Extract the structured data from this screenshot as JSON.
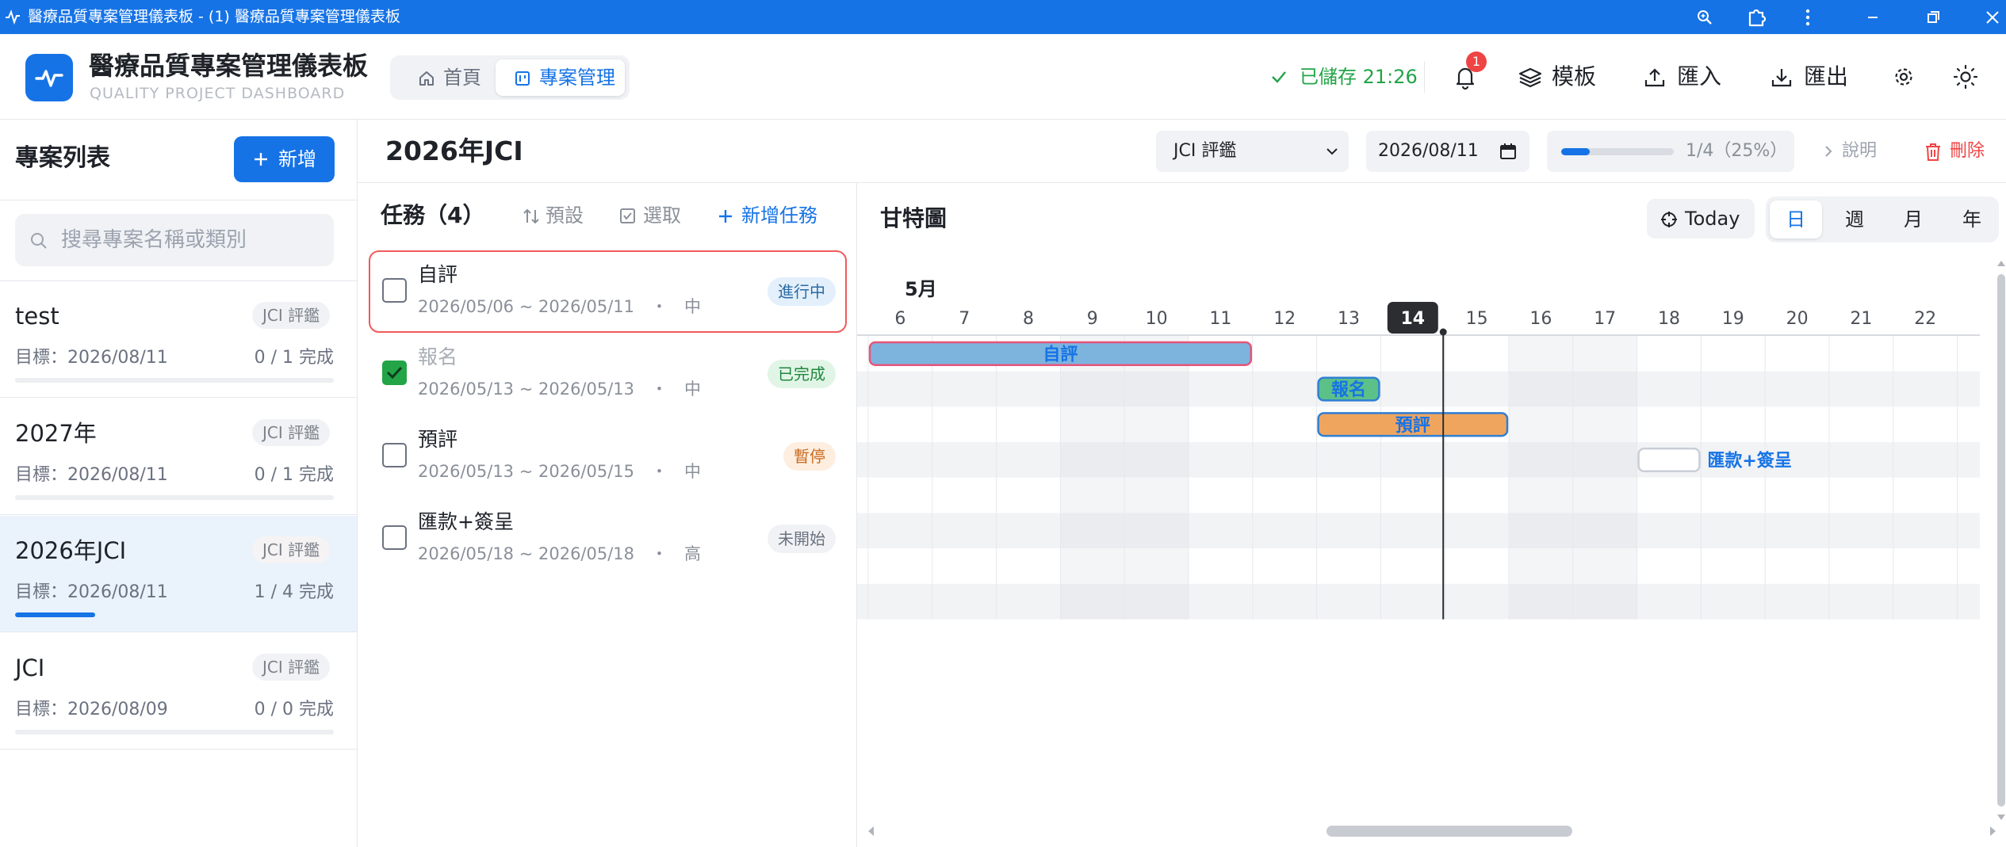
{
  "window": {
    "title": "醫療品質專案管理儀表板 - (1) 醫療品質專案管理儀表板"
  },
  "app": {
    "title": "醫療品質專案管理儀表板",
    "subtitle": "QUALITY PROJECT DASHBOARD",
    "accent": "#1673e6"
  },
  "nav": {
    "tabs": [
      {
        "label": "首頁",
        "icon": "home-icon"
      },
      {
        "label": "專案管理",
        "icon": "kanban-icon",
        "active": true
      }
    ]
  },
  "header": {
    "saved": "已儲存 21:26",
    "notification_count": "1",
    "template_label": "模板",
    "import_label": "匯入",
    "export_label": "匯出"
  },
  "sidebar": {
    "title": "專案列表",
    "new_label": "新增",
    "search_placeholder": "搜尋專案名稱或類別",
    "projects": [
      {
        "name": "test",
        "category": "JCI 評鑑",
        "target": "目標：2026/08/11",
        "count": "0 / 1 完成",
        "progress": 0,
        "active": false
      },
      {
        "name": "2027年",
        "category": "JCI 評鑑",
        "target": "目標：2026/08/11",
        "count": "0 / 1 完成",
        "progress": 0,
        "active": false
      },
      {
        "name": "2026年JCI",
        "category": "JCI 評鑑",
        "target": "目標：2026/08/11",
        "count": "1 / 4 完成",
        "progress": 0.25,
        "active": true
      },
      {
        "name": "JCI",
        "category": "JCI 評鑑",
        "target": "目標：2026/08/09",
        "count": "0 / 0 完成",
        "progress": 0,
        "active": false
      }
    ]
  },
  "project": {
    "title": "2026年JCI",
    "category_selected": "JCI 評鑑",
    "target_date": "2026/08/11",
    "progress": 0.25,
    "progress_text": "1/4（25%）",
    "help_label": "說明",
    "delete_label": "刪除"
  },
  "tasks": {
    "title": "任務（4）",
    "sort_label": "預設",
    "select_label": "選取",
    "add_label": "新增任務",
    "items": [
      {
        "name": "自評",
        "dates": "2026/05/06 ~ 2026/05/11",
        "priority": "中",
        "status": "進行中",
        "status_bg": "#e3f0fb",
        "status_fg": "#2d6aa3",
        "done": false,
        "selected": true
      },
      {
        "name": "報名",
        "dates": "2026/05/13 ~ 2026/05/13",
        "priority": "中",
        "status": "已完成",
        "status_bg": "#e1f5e6",
        "status_fg": "#21873f",
        "done": true,
        "selected": false
      },
      {
        "name": "預評",
        "dates": "2026/05/13 ~ 2026/05/15",
        "priority": "中",
        "status": "暫停",
        "status_bg": "#fdeee0",
        "status_fg": "#c96a1d",
        "done": false,
        "selected": false
      },
      {
        "name": "匯款+簽呈",
        "dates": "2026/05/18 ~ 2026/05/18",
        "priority": "高",
        "status": "未開始",
        "status_bg": "#f0f2f5",
        "status_fg": "#6b7280",
        "done": false,
        "selected": false
      }
    ]
  },
  "gantt": {
    "title": "甘特圖",
    "today_label": "Today",
    "views": [
      "日",
      "週",
      "月",
      "年"
    ],
    "active_view": "日",
    "month_label": "5月",
    "days": [
      "6",
      "7",
      "8",
      "9",
      "10",
      "11",
      "12",
      "13",
      "14",
      "15",
      "16",
      "17",
      "18",
      "19",
      "20",
      "21",
      "22"
    ],
    "today": "14",
    "weekend_days": [
      "9",
      "10",
      "16",
      "17"
    ],
    "bars": [
      {
        "label": "自評",
        "start": "6",
        "end": "11",
        "fill": "#7cb4de",
        "stroke": "#e8547a",
        "text": "#1673e6",
        "label_outside": false
      },
      {
        "label": "報名",
        "start": "13",
        "end": "13",
        "fill": "#5cc089",
        "stroke": "#2f7fd3",
        "text": "#1673e6",
        "label_outside": false
      },
      {
        "label": "預評",
        "start": "13",
        "end": "15",
        "fill": "#f0a55f",
        "stroke": "#2f7fd3",
        "text": "#1673e6",
        "label_outside": false
      },
      {
        "label": "匯款+簽呈",
        "start": "18",
        "end": "18",
        "fill": "#ffffff",
        "stroke": "#c9ced6",
        "text": "#1673e6",
        "label_outside": true
      }
    ]
  }
}
